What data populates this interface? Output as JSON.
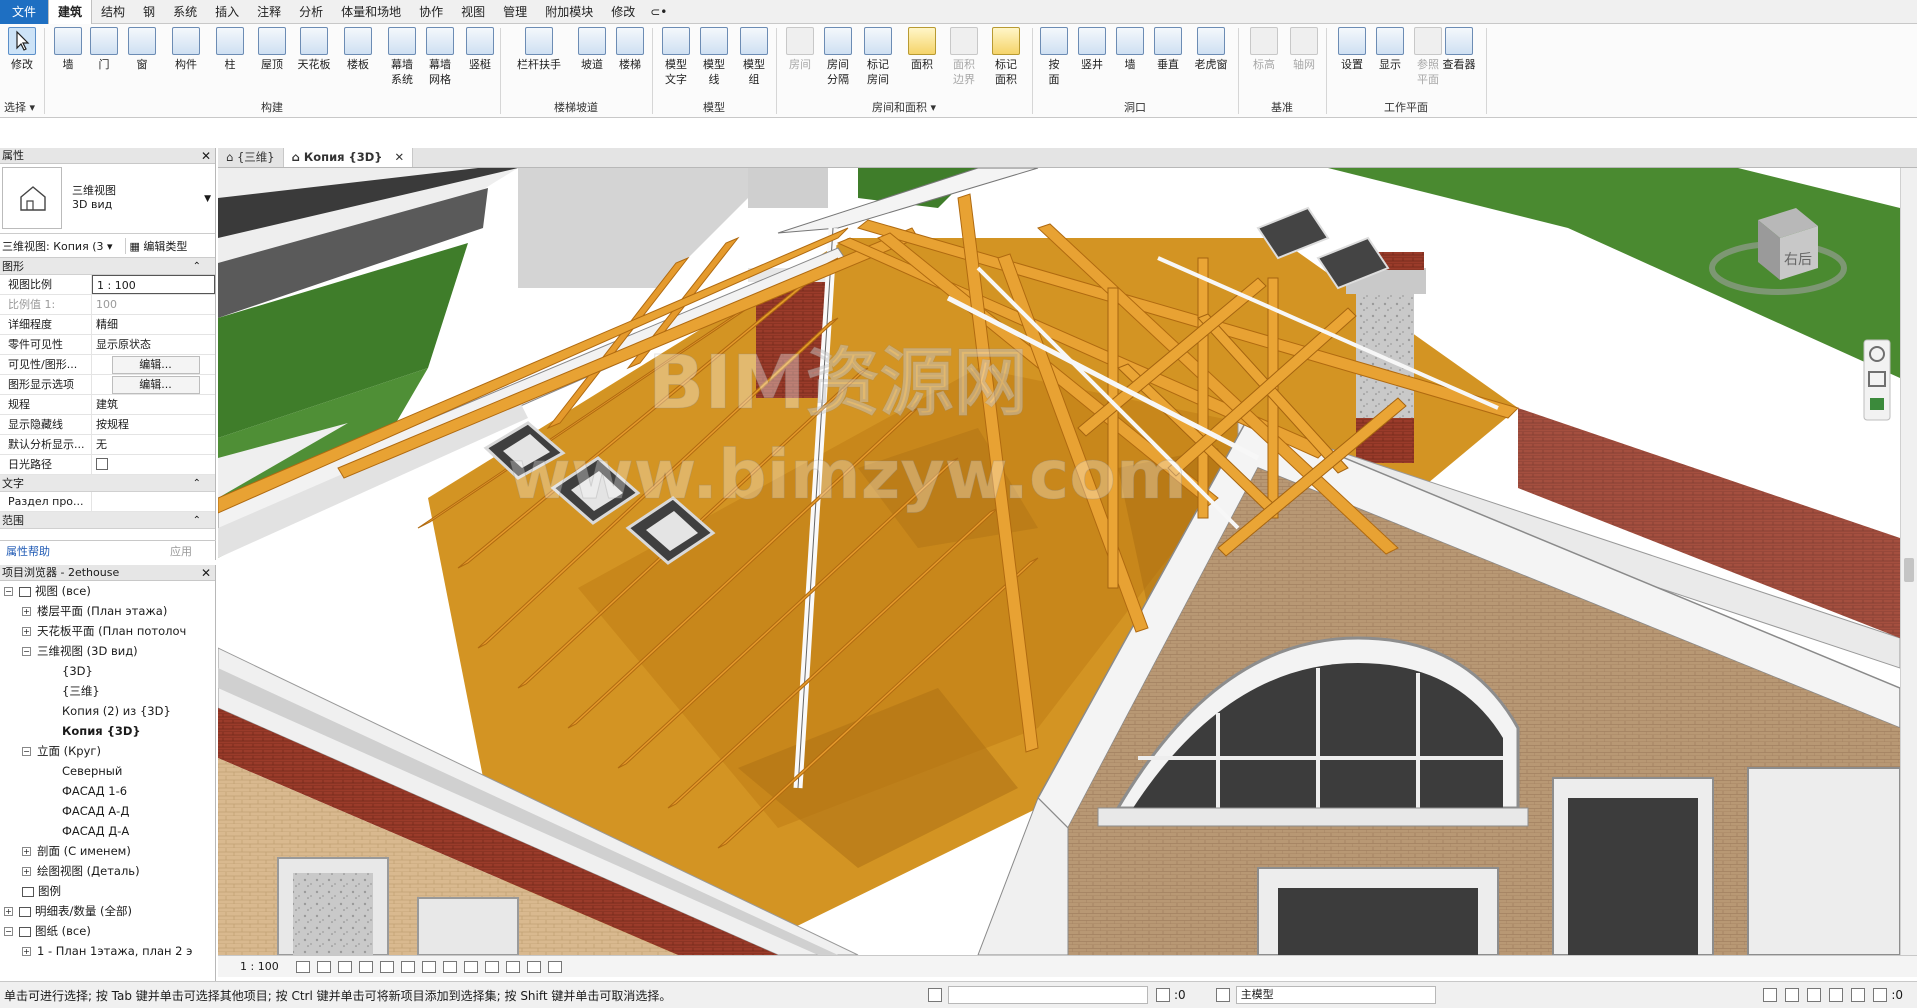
{
  "menubar": {
    "file": "文件",
    "tabs": [
      "建筑",
      "结构",
      "钢",
      "系统",
      "插入",
      "注释",
      "分析",
      "体量和场地",
      "协作",
      "视图",
      "管理",
      "附加模块",
      "修改"
    ],
    "context": "⊂•"
  },
  "ribbon": {
    "select": {
      "label": "修改",
      "group": "选择",
      "arrow": "▾"
    },
    "build": {
      "items": [
        "墙",
        "门",
        "窗",
        "构件",
        "柱",
        "屋顶",
        "天花板",
        "楼板",
        "幕墙\n系统",
        "幕墙\n网格",
        "竖梃"
      ],
      "group": "构建"
    },
    "circulation": {
      "items": [
        "栏杆扶手",
        "坡道",
        "楼梯"
      ],
      "group": "楼梯坡道"
    },
    "model": {
      "items": [
        "模型\n文字",
        "模型\n线",
        "模型\n组"
      ],
      "group": "模型"
    },
    "room": {
      "items": [
        "房间",
        "房间\n分隔",
        "标记\n房间",
        "面积",
        "面积\n边界",
        "标记\n面积"
      ],
      "group": "房间和面积",
      "arrow": "▾"
    },
    "opening": {
      "items": [
        "按\n面",
        "竖井",
        "墙",
        "垂直",
        "老虎窗"
      ],
      "group": "洞口"
    },
    "datum": {
      "items": [
        "标高",
        "轴网"
      ],
      "group": "基准"
    },
    "workplane": {
      "items": [
        "设置",
        "显示",
        "参照\n平面",
        "查看器"
      ],
      "group": "工作平面"
    }
  },
  "properties": {
    "title": "属性",
    "close": "✕",
    "type_line1": "三维视图",
    "type_line2": "3D вид",
    "selector": "三维视图: Копия (3 ▾",
    "edit_type": "编辑类型",
    "group_graphics": "图形",
    "group_text": "文字",
    "group_range": "范围",
    "rows": [
      {
        "k": "视图比例",
        "v": "1 : 100"
      },
      {
        "k": "比例值 1:",
        "v": "100"
      },
      {
        "k": "详细程度",
        "v": "精细"
      },
      {
        "k": "零件可见性",
        "v": "显示原状态"
      },
      {
        "k": "可见性/图形...",
        "v": "编辑..."
      },
      {
        "k": "图形显示选项",
        "v": "编辑..."
      },
      {
        "k": "规程",
        "v": "建筑"
      },
      {
        "k": "显示隐藏线",
        "v": "按规程"
      },
      {
        "k": "默认分析显示...",
        "v": "无"
      },
      {
        "k": "日光路径",
        "v": ""
      }
    ],
    "text_rows": [
      {
        "k": "Раздел про...",
        "v": ""
      }
    ],
    "help": "属性帮助",
    "apply": "应用"
  },
  "browser": {
    "title": "项目浏览器 - 2ethouse",
    "close": "✕",
    "items": [
      "视图 (все)",
      "楼层平面 (План этажа)",
      "天花板平面 (План потолоч",
      "三维视图 (3D вид)",
      "{3D}",
      "{三维}",
      "Копия (2) из {3D}",
      "Копия {3D}",
      "立面 (Круг)",
      "Северный",
      "ФАСАД 1-6",
      "ФАСАД А-Д",
      "ФАСАД Д-А",
      "剖面 (С именем)",
      "绘图视图 (Деталь)",
      "图例",
      "明细表/数量 (全部)",
      "图纸 (все)",
      "1 - План 1этажа, план 2 э"
    ]
  },
  "view_tabs": [
    {
      "label": "{三维}"
    },
    {
      "label": "Копия {3D}",
      "close": "✕"
    }
  ],
  "view_cube": {
    "face": "右后"
  },
  "watermark": {
    "line1": "BIM资源网",
    "line2": "www.bimzyw.com"
  },
  "view_control": {
    "scale": "1 : 100"
  },
  "status": {
    "hint": "单击可进行选择; 按 Tab 键并单击可选择其他项目; 按 Ctrl 键并单击可将新项目添加到选择集; 按 Shift 键并单击可取消选择。",
    "count": ":0",
    "model": "主模型",
    "filter": ":0"
  }
}
